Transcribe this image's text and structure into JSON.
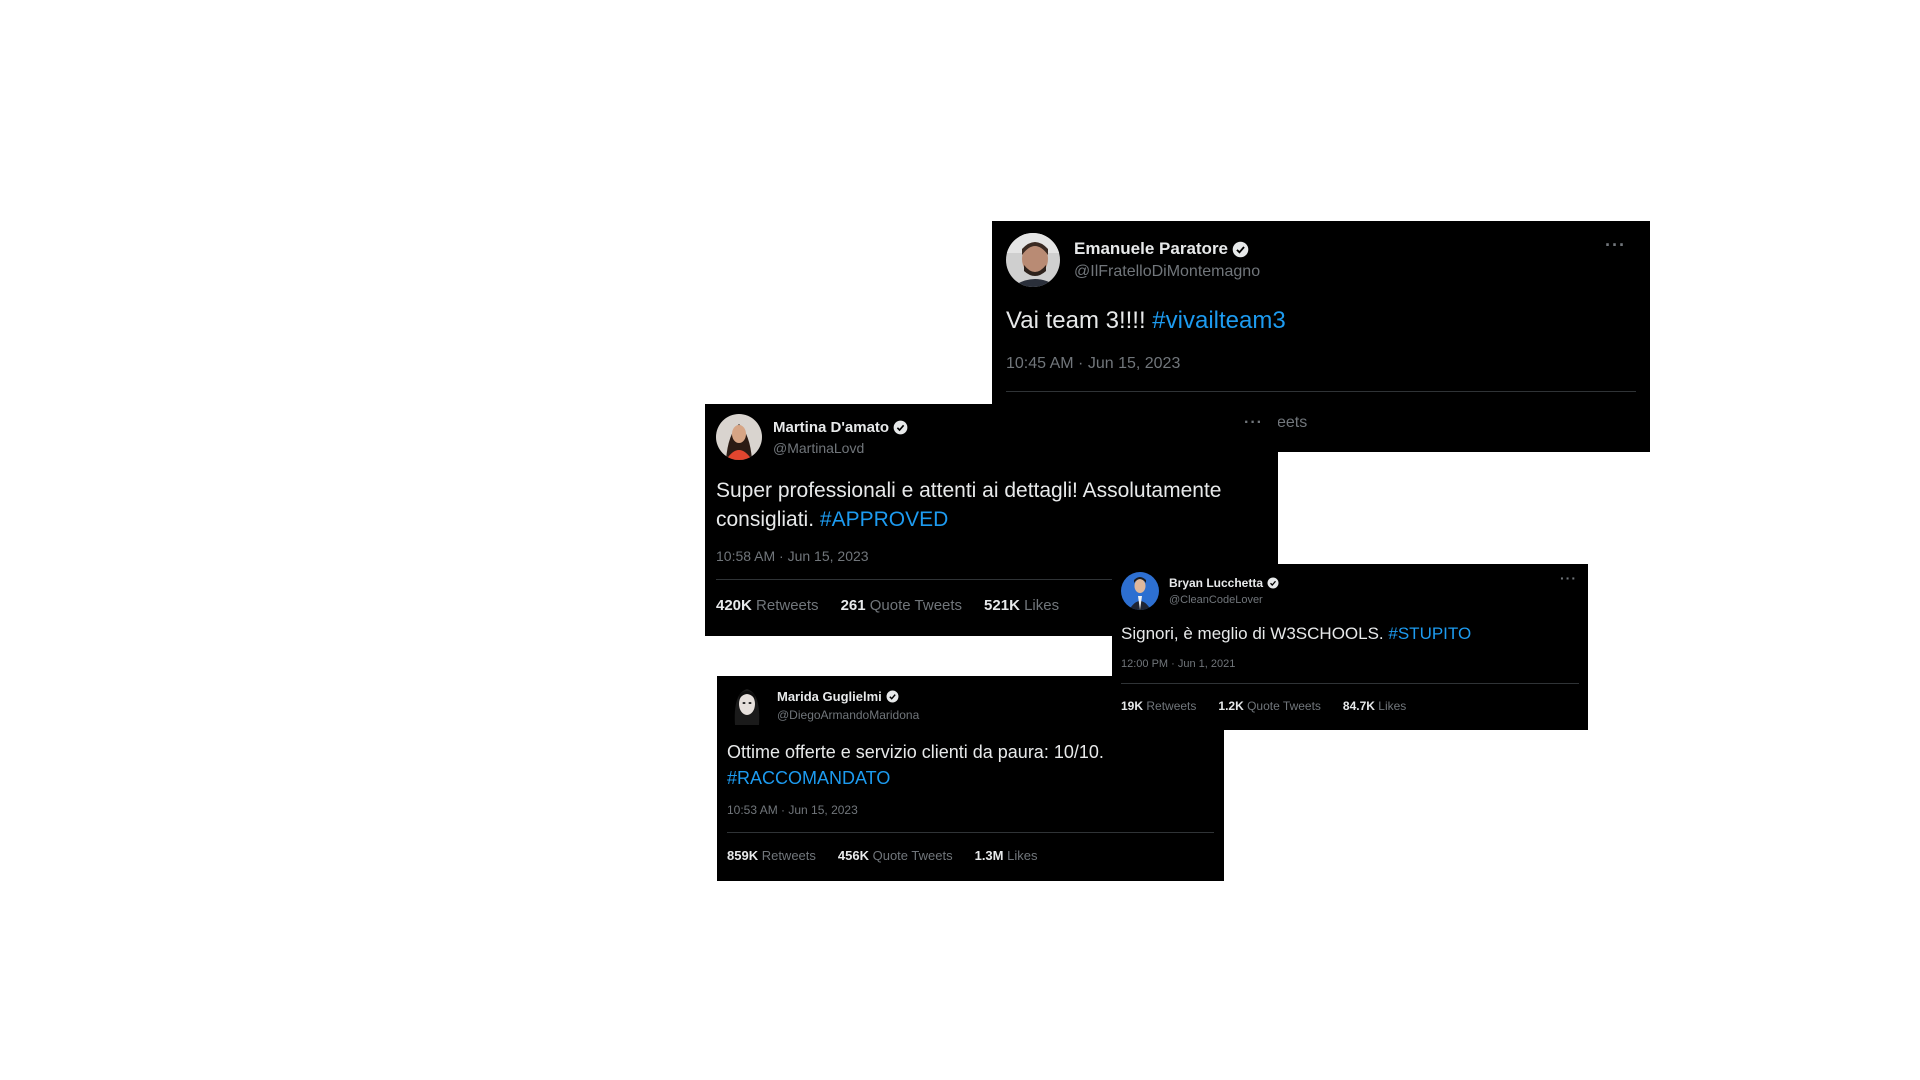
{
  "colors": {
    "background": "#ffffff",
    "card": "#000000",
    "text": "#e7e9ea",
    "muted": "#71767b",
    "hashtag": "#1d9bf0",
    "verified": "#e7e9ea"
  },
  "tweets": {
    "emanuele": {
      "name": "Emanuele Paratore",
      "handle": "@IlFratelloDiMontemagno",
      "text": "Vai team 3!!!! ",
      "hashtag": "#vivailteam3",
      "time": "10:45 AM · Jun 15, 2023",
      "stats_partial": "eets",
      "more": "···"
    },
    "martina": {
      "name": "Martina D'amato",
      "handle": "@MartinaLovd",
      "text": "Super professionali e attenti ai dettagli! Assolutamente consigliati. ",
      "hashtag": "#APPROVED",
      "time": "10:58 AM · Jun 15, 2023",
      "more": "···",
      "retweets": "420K",
      "retweets_label": "Retweets",
      "quotes": "261",
      "quotes_label": "Quote Tweets",
      "likes": "521K",
      "likes_label": "Likes"
    },
    "marida": {
      "name": "Marida Guglielmi",
      "handle": "@DiegoArmandoMaridona",
      "text": "Ottime offerte e servizio clienti da paura: 10/10. ",
      "hashtag": "#RACCOMANDATO",
      "time": "10:53 AM · Jun 15, 2023",
      "retweets": "859K",
      "retweets_label": "Retweets",
      "quotes": "456K",
      "quotes_label": "Quote Tweets",
      "likes": "1.3M",
      "likes_label": "Likes"
    },
    "bryan": {
      "name": "Bryan Lucchetta",
      "handle": "@CleanCodeLover",
      "text": "Signori, è meglio di W3SCHOOLS. ",
      "hashtag": "#STUPITO",
      "time": "12:00 PM · Jun 1, 2021",
      "more": "···",
      "retweets": "19K",
      "retweets_label": "Retweets",
      "quotes": "1.2K",
      "quotes_label": "Quote Tweets",
      "likes": "84.7K",
      "likes_label": "Likes"
    }
  },
  "icons": {
    "verified": "verified-badge-icon",
    "more": "more-options-icon",
    "avatar": "user-avatar"
  }
}
